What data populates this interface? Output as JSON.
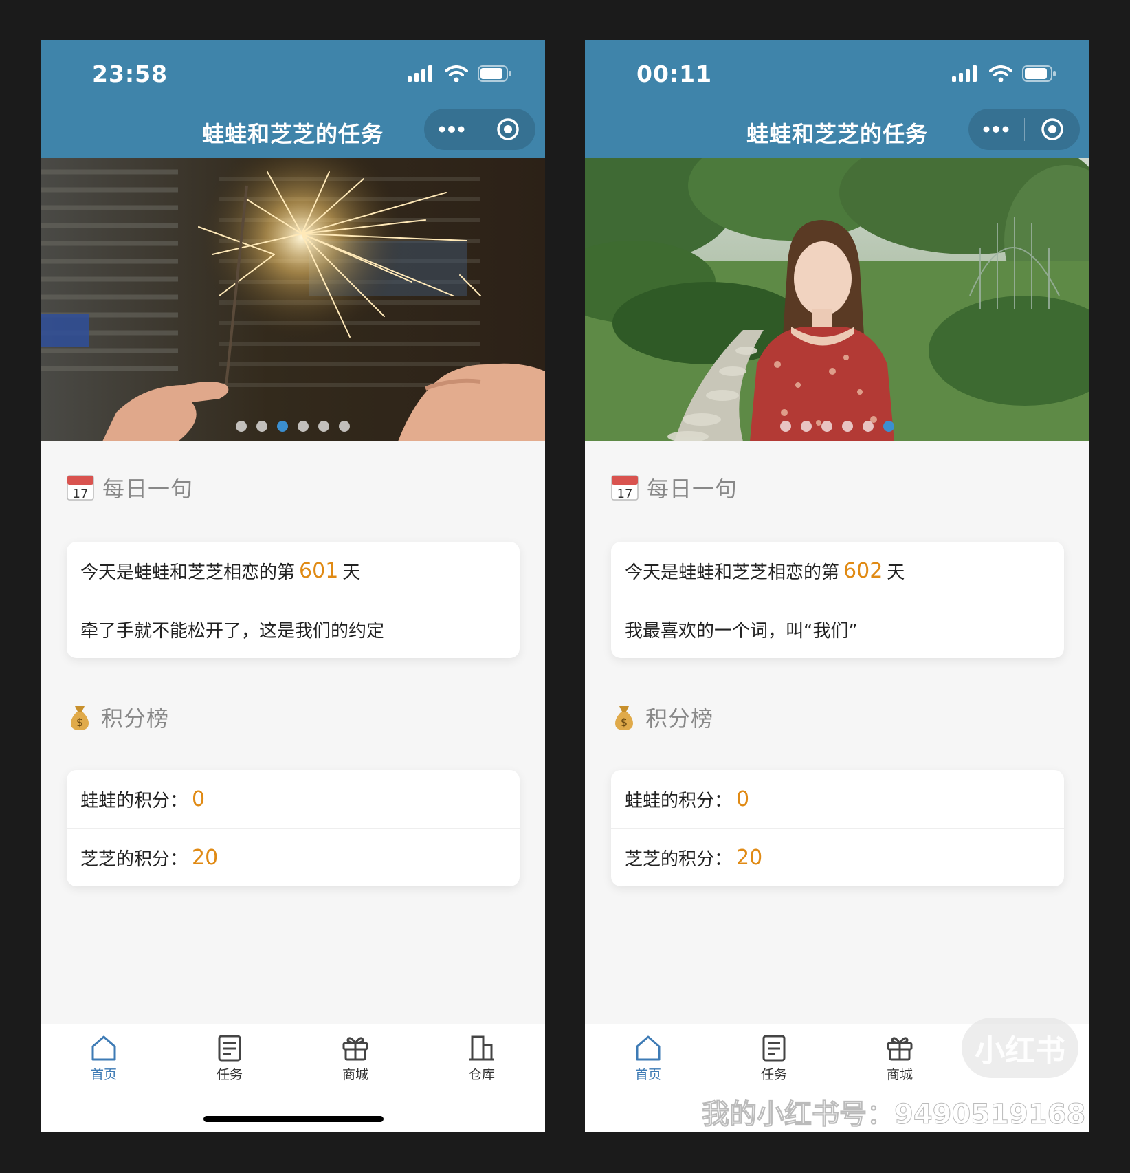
{
  "app": {
    "title": "蛙蛙和芝芝的任务"
  },
  "screens": [
    {
      "status_time": "23:58",
      "banner": {
        "dot_count": 6,
        "active_dot": 2
      },
      "daily": {
        "section_title": "每日一句",
        "love_prefix": "今天是蛙蛙和芝芝相恋的第",
        "days": "601",
        "love_suffix": "天",
        "quote": "牵了手就不能松开了，这是我们的约定"
      },
      "scores": {
        "section_title": "积分榜",
        "items": [
          {
            "label": "蛙蛙的积分：",
            "value": "0"
          },
          {
            "label": "芝芝的积分：",
            "value": "20"
          }
        ]
      },
      "tabs": [
        {
          "label": "首页",
          "icon": "home-icon"
        },
        {
          "label": "任务",
          "icon": "task-icon"
        },
        {
          "label": "商城",
          "icon": "gift-icon"
        },
        {
          "label": "仓库",
          "icon": "warehouse-icon"
        }
      ]
    },
    {
      "status_time": "00:11",
      "banner": {
        "dot_count": 6,
        "active_dot": 5
      },
      "daily": {
        "section_title": "每日一句",
        "love_prefix": "今天是蛙蛙和芝芝相恋的第",
        "days": "602",
        "love_suffix": "天",
        "quote": "我最喜欢的一个词，叫“我们”"
      },
      "scores": {
        "section_title": "积分榜",
        "items": [
          {
            "label": "蛙蛙的积分：",
            "value": "0"
          },
          {
            "label": "芝芝的积分：",
            "value": "20"
          }
        ]
      },
      "tabs": [
        {
          "label": "首页",
          "icon": "home-icon"
        },
        {
          "label": "任务",
          "icon": "task-icon"
        },
        {
          "label": "商城",
          "icon": "gift-icon"
        }
      ],
      "watermark": {
        "badge": "小红书",
        "line": "我的小红书号：9490519168"
      }
    }
  ],
  "colors": {
    "nav_bar": "#3f84aa",
    "accent": "#e08a14",
    "tab_active": "#3e7bb5",
    "page_bg": "#f6f6f6"
  }
}
